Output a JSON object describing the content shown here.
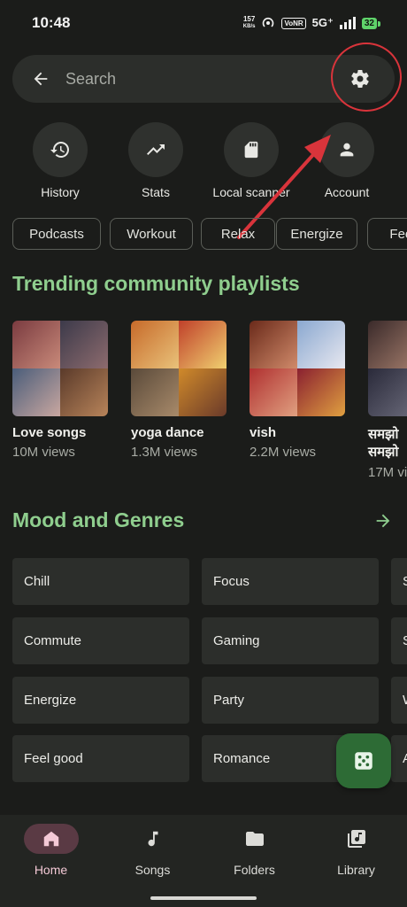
{
  "status_bar": {
    "time": "10:48",
    "net_speed_value": "157",
    "net_speed_unit": "KB/s",
    "volte": "VoNR",
    "network": "5G⁺",
    "battery": "32"
  },
  "search": {
    "placeholder": "Search",
    "back_icon": "arrow-left-icon",
    "settings_icon": "gear-icon"
  },
  "quick_actions": [
    {
      "label": "History",
      "icon": "history-icon"
    },
    {
      "label": "Stats",
      "icon": "trending-icon"
    },
    {
      "label": "Local scanner",
      "icon": "sd-card-icon"
    },
    {
      "label": "Account",
      "icon": "person-icon"
    }
  ],
  "chips": [
    "Podcasts",
    "Workout",
    "Relax",
    "Energize",
    "Feel"
  ],
  "sections": {
    "trending_title": "Trending community playlists",
    "mood_title": "Mood and Genres"
  },
  "playlists": [
    {
      "title": "Love songs",
      "subtitle": "",
      "views": "10M views"
    },
    {
      "title": "yoga dance",
      "subtitle": "",
      "views": "1.3M views"
    },
    {
      "title": "vish",
      "subtitle": "",
      "views": "2.2M views"
    },
    {
      "title": "समझो",
      "subtitle": "समझो",
      "views": "17M vi"
    }
  ],
  "genres": {
    "col1": [
      "Chill",
      "Commute",
      "Energize",
      "Feel good"
    ],
    "col2": [
      "Focus",
      "Gaming",
      "Party",
      "Romance"
    ],
    "col3": [
      "S",
      "S",
      "W",
      "A"
    ]
  },
  "bottom_nav": [
    {
      "label": "Home",
      "icon": "home-icon",
      "active": true
    },
    {
      "label": "Songs",
      "icon": "music-note-icon",
      "active": false
    },
    {
      "label": "Folders",
      "icon": "folder-icon",
      "active": false
    },
    {
      "label": "Library",
      "icon": "library-icon",
      "active": false
    }
  ],
  "colors": {
    "background": "#1b1c1a",
    "accent_green": "#8fce8e",
    "annotation_red": "#d9343b",
    "fab_green": "#2d6b35",
    "active_nav": "#5a3a44"
  }
}
